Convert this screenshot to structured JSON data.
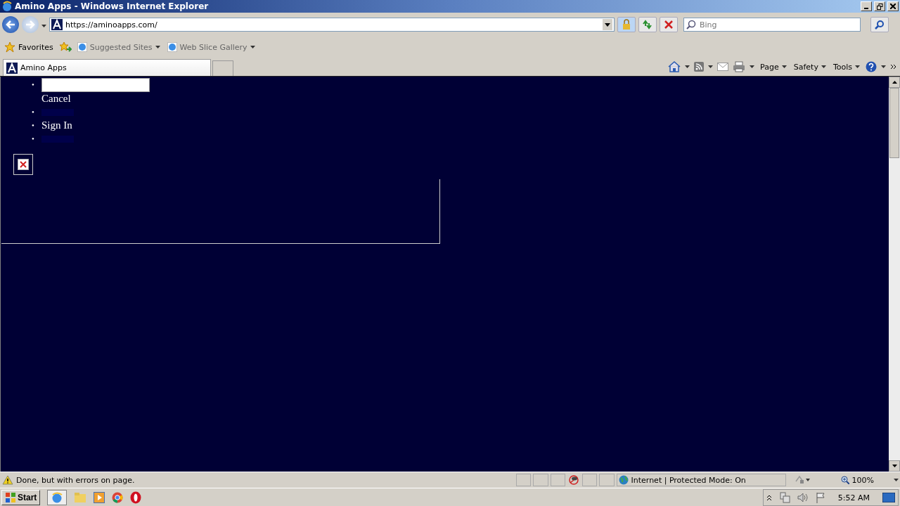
{
  "window": {
    "title": "Amino Apps - Windows Internet Explorer"
  },
  "address_bar": {
    "url": "https://aminoapps.com/"
  },
  "search": {
    "placeholder": "Bing"
  },
  "favorites_bar": {
    "label": "Favorites",
    "links": [
      {
        "label": "Suggested Sites"
      },
      {
        "label": "Web Slice Gallery"
      }
    ]
  },
  "tabs": [
    {
      "label": "Amino Apps",
      "selected": true
    }
  ],
  "command_bar": {
    "menus": [
      {
        "label": "Page"
      },
      {
        "label": "Safety"
      },
      {
        "label": "Tools"
      }
    ]
  },
  "page": {
    "menu": [
      {
        "kind": "search",
        "marker": "•",
        "cancel": "Cancel"
      },
      {
        "kind": "hidden_link",
        "marker": "•"
      },
      {
        "kind": "text",
        "marker": "•",
        "label": "Sign In"
      },
      {
        "kind": "hidden_link",
        "marker": "•"
      }
    ]
  },
  "status_bar": {
    "message": "Done, but with errors on page.",
    "zone": "Internet | Protected Mode: On",
    "zoom": "100%"
  },
  "taskbar": {
    "start": "Start",
    "clock": "5:52 AM"
  }
}
